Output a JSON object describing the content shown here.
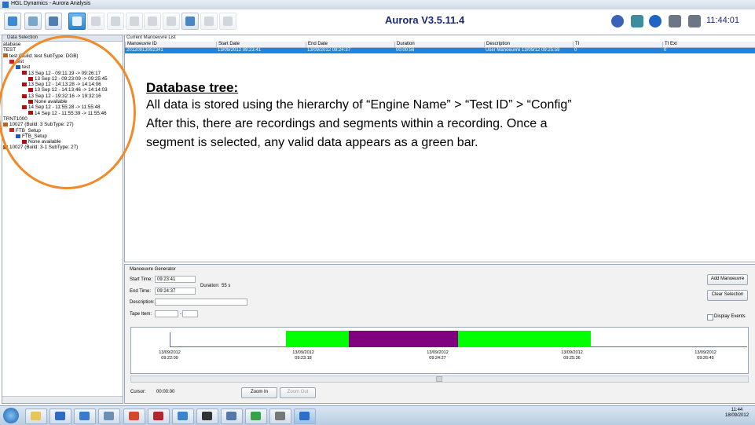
{
  "window": {
    "title": "HGL Dynamics - Aurora Analysis"
  },
  "toolbar": {
    "left_buttons": [
      {
        "icon": "add-database-icon",
        "state": "normal"
      },
      {
        "icon": "network-icon",
        "state": "normal"
      },
      {
        "icon": "computer-icon",
        "state": "normal"
      },
      {
        "icon": "data-tree-icon",
        "state": "active"
      },
      {
        "icon": "settings-icon",
        "state": "disabled"
      },
      {
        "icon": "tools-icon",
        "state": "disabled"
      },
      {
        "icon": "check-icon",
        "state": "disabled"
      },
      {
        "icon": "chart-icon",
        "state": "disabled"
      },
      {
        "icon": "export-icon",
        "state": "disabled"
      },
      {
        "icon": "hierarchy-icon",
        "state": "normal"
      },
      {
        "icon": "edit-icon",
        "state": "disabled"
      },
      {
        "icon": "graph-icon",
        "state": "disabled"
      }
    ],
    "app_version": "Aurora V3.5.11.4",
    "right_icons": [
      "help-icon",
      "upload-icon",
      "globe-icon",
      "printer-icon",
      "print-preview-icon"
    ],
    "clock": "11:44:01"
  },
  "data_selection": {
    "title": "Data Selection",
    "tree": [
      {
        "label": "atabase",
        "level": 0,
        "icon": "none"
      },
      {
        "label": "TEST",
        "level": 0,
        "icon": "none"
      },
      {
        "label": "test (Build: test  SubType: DGB)",
        "level": 0,
        "icon": "engine-icon"
      },
      {
        "label": "test",
        "level": 1,
        "icon": "test-icon"
      },
      {
        "label": "test",
        "level": 2,
        "icon": "config-icon"
      },
      {
        "label": "13 Sep 12 - 09:11:19 -> 09:26:17",
        "level": 3,
        "icon": "recording-icon"
      },
      {
        "label": "13 Sep 12 - 09:23:09 -> 09:25:45",
        "level": 4,
        "icon": "segment-icon"
      },
      {
        "label": "13 Sep 12 - 14:13:28 -> 14:14:06",
        "level": 3,
        "icon": "recording-icon"
      },
      {
        "label": "13 Sep 12 - 14:13:46 -> 14:14:03",
        "level": 4,
        "icon": "segment-icon"
      },
      {
        "label": "13 Sep 12 - 19:32:16 -> 19:32:16",
        "level": 3,
        "icon": "recording-icon"
      },
      {
        "label": "None available",
        "level": 4,
        "icon": "segment-icon"
      },
      {
        "label": "14 Sep 12 - 11:55:28 -> 11:55:48",
        "level": 3,
        "icon": "recording-icon"
      },
      {
        "label": "14 Sep 12 - 11:55:39 -> 11:55:46",
        "level": 4,
        "icon": "segment-icon"
      },
      {
        "label": "TRNT1000",
        "level": 0,
        "icon": "none"
      },
      {
        "label": "10027 (Build: 3  SubType: 27)",
        "level": 0,
        "icon": "engine-icon"
      },
      {
        "label": "FTB_Setup",
        "level": 1,
        "icon": "test-icon"
      },
      {
        "label": "FTB_Setup",
        "level": 2,
        "icon": "config-icon"
      },
      {
        "label": "None available",
        "level": 3,
        "icon": "recording-icon"
      },
      {
        "label": "10027 (Build: 3-1  SubType: 27)",
        "level": 0,
        "icon": "engine-icon"
      }
    ]
  },
  "manoeuvre_list": {
    "title": "Current Manoeuvre List",
    "columns": [
      "Manoeuvre ID",
      "Start Date",
      "End Date",
      "Duration",
      "Description",
      "TI",
      "TI Ext"
    ],
    "rows": [
      [
        "20120913092341",
        "13/09/2012 09:23:41",
        "13/09/2012 09:24:37",
        "00:00:56",
        "User Manoeuvre 13/09/12 09:25:59",
        "0",
        "0"
      ]
    ]
  },
  "generator": {
    "title": "Manoeuvre Generator",
    "start_label": "Start Time:",
    "start_value": "09:23:41",
    "end_label": "End Time:",
    "end_value": "09:24:37",
    "duration_label": "Duration:",
    "duration_value": "55 s",
    "description_label": "Description:",
    "description_value": "",
    "tape_label": "Tape Item:",
    "tape_value1": "",
    "tape_sep": "-",
    "tape_value2": "",
    "add_button": "Add Manoeuvre",
    "clear_button": "Clear Selection",
    "display_events": "Display Events",
    "cursor_label": "Cursor:",
    "cursor_value": "00:00:00",
    "zoom_in": "Zoom In",
    "zoom_out": "Zoom Out",
    "timeline": {
      "colors": {
        "valid": "#00ff00",
        "selected": "#800080"
      },
      "ticks": [
        {
          "date": "13/09/2012",
          "time": "09:22:09"
        },
        {
          "date": "13/09/2012",
          "time": "09:23:18"
        },
        {
          "date": "13/09/2012",
          "time": "09:24:27"
        },
        {
          "date": "13/09/2012",
          "time": "09:25:36"
        },
        {
          "date": "13/09/2012",
          "time": "09:26:45"
        }
      ]
    }
  },
  "annotation": {
    "heading": "Database tree:",
    "lines": [
      "All data is stored using the hierarchy of “Engine Name” > “Test ID” > “Config”",
      "After this, there are recordings and segments within a recording. Once a",
      "segment is selected, any valid data appears as a green bar."
    ],
    "color": "#f08a2a"
  },
  "taskbar": {
    "apps": [
      "start-orb-icon",
      "folder-icon",
      "shield-icon",
      "media-icon",
      "network-icon",
      "chrome-icon",
      "document-icon",
      "clock-icon",
      "camera-icon",
      "file-icon",
      "spreadsheet-icon",
      "app-icon",
      "aurora-icon"
    ],
    "time": "11:44",
    "date": "18/09/2012"
  }
}
